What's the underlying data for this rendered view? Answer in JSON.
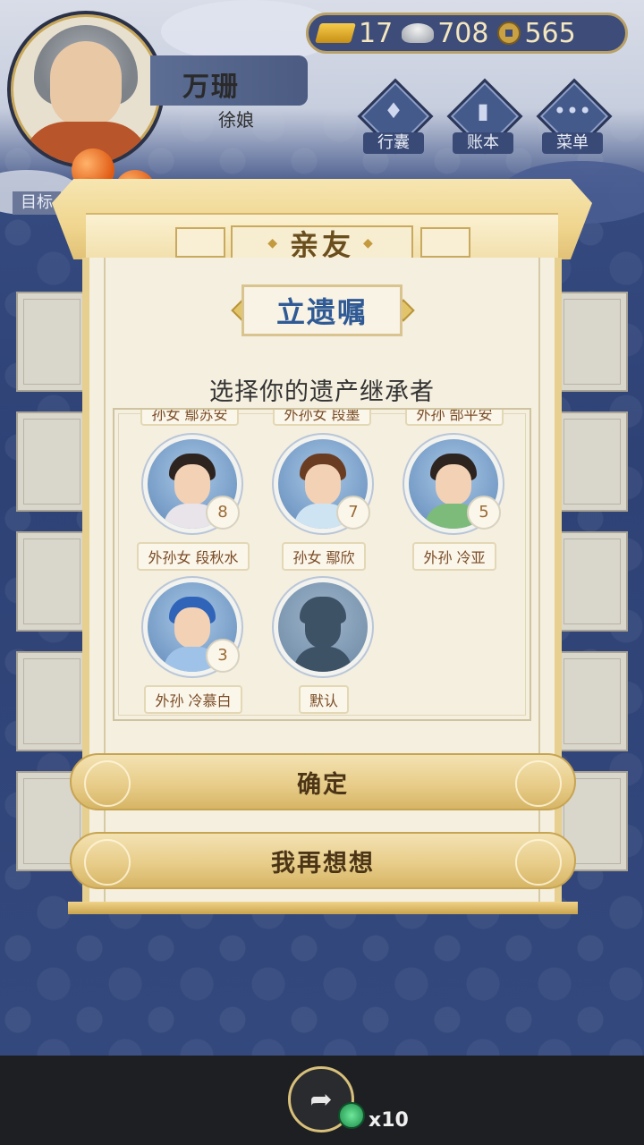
{
  "player": {
    "name": "万珊",
    "role": "徐娘"
  },
  "currency": {
    "gold": "17",
    "silver": "708",
    "coins": "565"
  },
  "menu": {
    "bag": "行囊",
    "ledger": "账本",
    "menu": "菜单"
  },
  "goal": {
    "label": "目标"
  },
  "panel": {
    "title": "亲友",
    "subtitle": "立遗嘱",
    "prompt": "选择你的遗产继承者"
  },
  "partial_heirs": [
    {
      "name": "孙女 鄢苏安"
    },
    {
      "name": "外孙女 段墨"
    },
    {
      "name": "外孙 郜平安"
    }
  ],
  "heirs": [
    {
      "name": "外孙女 段秋水",
      "level": "8"
    },
    {
      "name": "孙女 鄢欣",
      "level": "7"
    },
    {
      "name": "外孙 冷亚",
      "level": "5"
    },
    {
      "name": "外孙 冷慕白",
      "level": "3"
    },
    {
      "name": "默认"
    }
  ],
  "buttons": {
    "confirm": "确定",
    "reconsider": "我再想想"
  },
  "bottom": {
    "token_count": "x10"
  },
  "colors": {
    "accent_gold": "#c9a95e",
    "title_blue": "#2f5a95",
    "background_blue": "#34497e"
  }
}
